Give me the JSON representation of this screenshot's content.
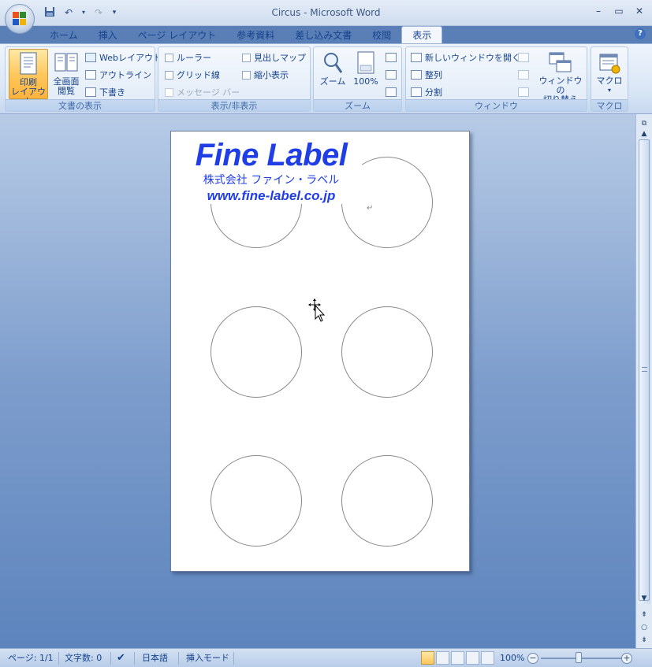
{
  "window": {
    "title": "Circus - Microsoft Word"
  },
  "qat": {
    "save_icon": "save-icon",
    "undo_icon": "undo-icon",
    "redo_icon": "redo-icon",
    "customize_icon": "qat-customize-icon"
  },
  "tabs": [
    {
      "label": "ホーム"
    },
    {
      "label": "挿入"
    },
    {
      "label": "ページ レイアウト"
    },
    {
      "label": "参考資料"
    },
    {
      "label": "差し込み文書"
    },
    {
      "label": "校閲"
    },
    {
      "label": "表示"
    }
  ],
  "active_tab": "表示",
  "ribbon": {
    "doc_view": {
      "group_label": "文書の表示",
      "print_layout": "印刷\nレイアウト",
      "print_layout_l1": "印刷",
      "print_layout_l2": "レイアウト",
      "full_screen_l1": "全画面",
      "full_screen_l2": "閲覧",
      "web_layout": "Webレイアウト",
      "outline": "アウトライン",
      "draft": "下書き"
    },
    "show_hide": {
      "group_label": "表示/非表示",
      "ruler": "ルーラー",
      "gridlines": "グリッド線",
      "message_bar": "メッセージ バー",
      "doc_map": "見出しマップ",
      "thumbnails": "縮小表示"
    },
    "zoom": {
      "group_label": "ズーム",
      "zoom": "ズーム",
      "hundred": "100%"
    },
    "window": {
      "group_label": "ウィンドウ",
      "new_window": "新しいウィンドウを開く",
      "arrange": "整列",
      "split": "分割",
      "switch_l1": "ウィンドウの",
      "switch_l2": "切り替え"
    },
    "macro": {
      "group_label": "マクロ",
      "macro": "マクロ"
    }
  },
  "document": {
    "logo_title": "Fine Label",
    "logo_company": "株式会社 ファイン・ラベル",
    "logo_url": "www.fine-label.co.jp",
    "paragraph_mark": "↵"
  },
  "statusbar": {
    "page": "ページ: 1/1",
    "word_count": "文字数: 0",
    "language": "日本語",
    "insert_mode": "挿入モード",
    "zoom_level": "100%"
  },
  "colors": {
    "logo_blue": "#1f3ee6",
    "ribbon_active": "#ffc85e"
  }
}
